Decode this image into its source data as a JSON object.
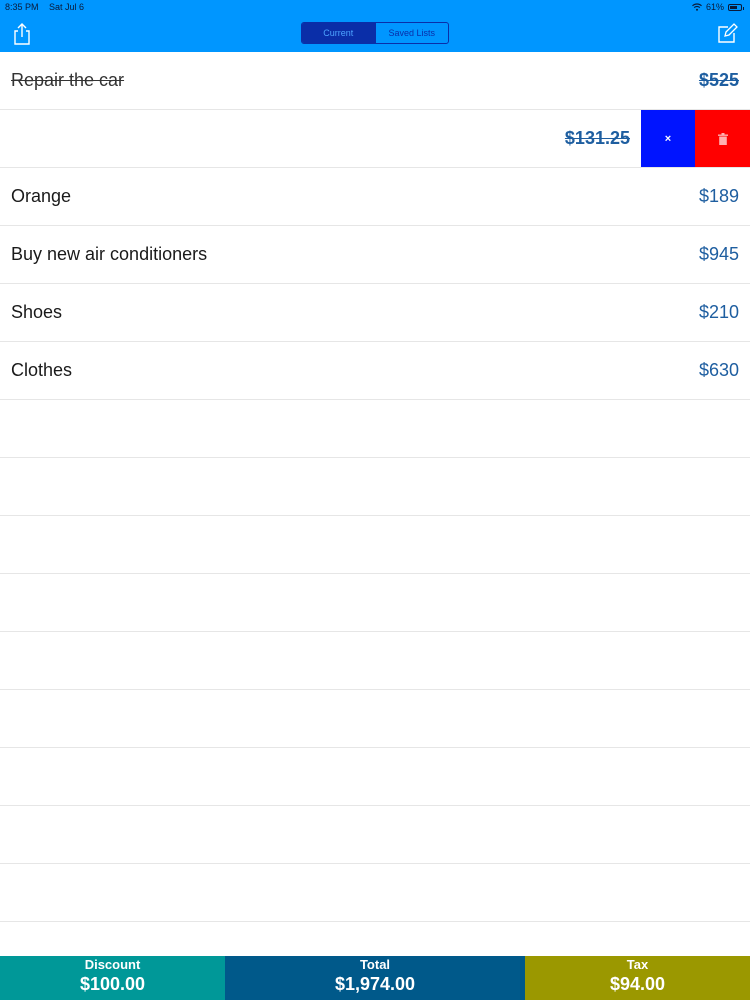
{
  "status_bar": {
    "time": "8:35 PM",
    "date": "Sat Jul 6",
    "battery": "61%",
    "wifi_icon": "wifi-icon",
    "battery_icon": "battery-icon"
  },
  "nav": {
    "share_icon": "share-icon",
    "compose_icon": "compose-icon",
    "segments": [
      "Current",
      "Saved Lists"
    ],
    "selected_segment": "Current"
  },
  "items": [
    {
      "name": "Repair the car",
      "price": "$525",
      "done": true
    },
    {
      "name": "",
      "price": "$131.25",
      "done": true,
      "swiped": true
    },
    {
      "name": "Orange",
      "price": "$189",
      "done": false
    },
    {
      "name": "Buy new air conditioners",
      "price": "$945",
      "done": false
    },
    {
      "name": "Shoes",
      "price": "$210",
      "done": false
    },
    {
      "name": "Clothes",
      "price": "$630",
      "done": false
    }
  ],
  "swipe_actions": {
    "cancel_label": "×",
    "delete_icon": "trash-icon"
  },
  "footer": {
    "discount": {
      "label": "Discount",
      "value": "$100.00"
    },
    "total": {
      "label": "Total",
      "value": "$1,974.00"
    },
    "tax": {
      "label": "Tax",
      "value": "$94.00"
    }
  },
  "colors": {
    "nav_background": "#0096ff",
    "discount": "#009898",
    "total": "#00598a",
    "tax": "#9b9800",
    "swipe_cancel": "#0014ff",
    "swipe_delete": "#ff0000",
    "price_text": "#1e5ea0"
  }
}
